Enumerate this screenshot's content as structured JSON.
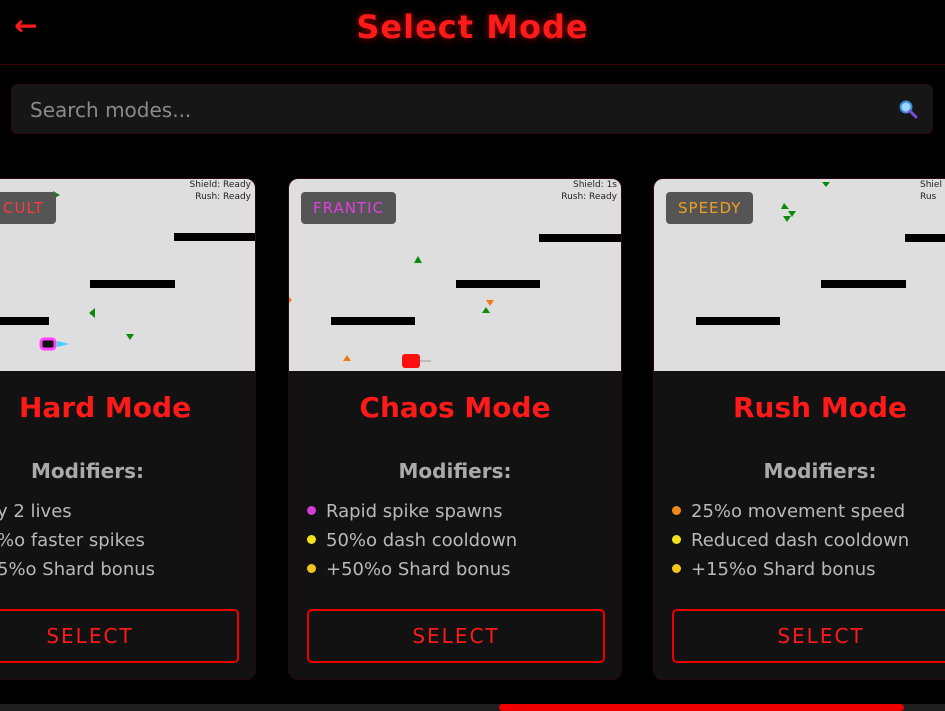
{
  "header": {
    "back_icon": "arrow-left-icon",
    "back_glyph": "←",
    "title": "Select Mode"
  },
  "search": {
    "placeholder": "Search modes...",
    "icon": "magnifier-icon"
  },
  "colors": {
    "accent": "#ff1a1a",
    "background": "#000000",
    "card": "#121212",
    "preview": "#dedede"
  },
  "cards": [
    {
      "badge": "CULT",
      "badge_color": "#ff3a3a",
      "status_lines": [
        "Shield: Ready",
        "Rush: Ready"
      ],
      "name": "Hard Mode",
      "modifiers_heading": "Modifiers:",
      "modifiers": [
        {
          "text": "y 2 lives",
          "dot": "none"
        },
        {
          "text": "%o faster spikes",
          "dot": "none"
        },
        {
          "text": "5%o Shard bonus",
          "dot": "none"
        }
      ],
      "select_label": "SELECT"
    },
    {
      "badge": "FRANTIC",
      "badge_color": "#e040e0",
      "status_lines": [
        "Shield: 1s",
        "Rush: Ready"
      ],
      "name": "Chaos Mode",
      "modifiers_heading": "Modifiers:",
      "modifiers": [
        {
          "text": "Rapid spike spawns",
          "dot": "#d63ad6"
        },
        {
          "text": "50%o dash cooldown",
          "dot": "#f2e21a"
        },
        {
          "text": "+50%o Shard bonus",
          "dot": "#f2c51a"
        }
      ],
      "select_label": "SELECT"
    },
    {
      "badge": "SPEEDY",
      "badge_color": "#f0a020",
      "status_lines": [
        "Shiel",
        "Rus"
      ],
      "name": "Rush Mode",
      "modifiers_heading": "Modifiers:",
      "modifiers": [
        {
          "text": "25%o movement speed",
          "dot": "#f08a1a"
        },
        {
          "text": "Reduced dash cooldown",
          "dot": "#f2e21a"
        },
        {
          "text": "+15%o Shard bonus",
          "dot": "#f2c51a"
        }
      ],
      "select_label": "SELECT"
    }
  ]
}
